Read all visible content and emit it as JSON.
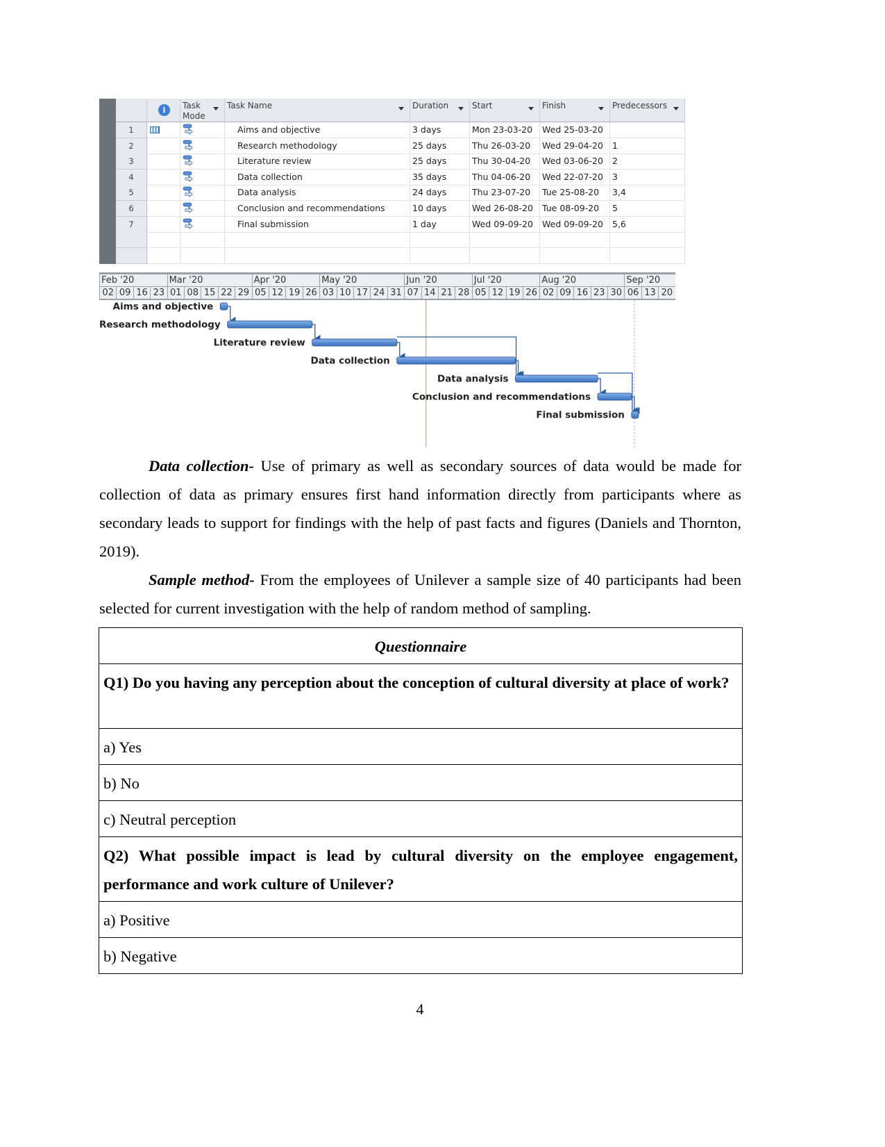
{
  "project_table": {
    "columns": {
      "info": "i",
      "task_mode": "Task Mode",
      "task_name": "Task Name",
      "duration": "Duration",
      "start": "Start",
      "finish": "Finish",
      "predecessors": "Predecessors"
    },
    "rows": [
      {
        "id": "1",
        "name": "Aims and objective",
        "duration": "3 days",
        "start": "Mon 23-03-20",
        "finish": "Wed 25-03-20",
        "predecessors": "",
        "indicator": "calendar-icon"
      },
      {
        "id": "2",
        "name": "Research methodology",
        "duration": "25 days",
        "start": "Thu 26-03-20",
        "finish": "Wed 29-04-20",
        "predecessors": "1"
      },
      {
        "id": "3",
        "name": "Literature review",
        "duration": "25 days",
        "start": "Thu 30-04-20",
        "finish": "Wed 03-06-20",
        "predecessors": "2"
      },
      {
        "id": "4",
        "name": "Data collection",
        "duration": "35 days",
        "start": "Thu 04-06-20",
        "finish": "Wed 22-07-20",
        "predecessors": "3"
      },
      {
        "id": "5",
        "name": "Data analysis",
        "duration": "24 days",
        "start": "Thu 23-07-20",
        "finish": "Tue 25-08-20",
        "predecessors": "3,4"
      },
      {
        "id": "6",
        "name": "Conclusion and recommendations",
        "duration": "10 days",
        "start": "Wed 26-08-20",
        "finish": "Tue 08-09-20",
        "predecessors": "5"
      },
      {
        "id": "7",
        "name": "Final submission",
        "duration": "1 day",
        "start": "Wed 09-09-20",
        "finish": "Wed 09-09-20",
        "predecessors": "5,6"
      }
    ]
  },
  "gantt": {
    "months": [
      "Feb '20",
      "Mar '20",
      "Apr '20",
      "May '20",
      "Jun '20",
      "Jul '20",
      "Aug '20",
      "Sep '20"
    ],
    "weeks": [
      "02",
      "09",
      "16",
      "23",
      "01",
      "08",
      "15",
      "22",
      "29",
      "05",
      "12",
      "19",
      "26",
      "03",
      "10",
      "17",
      "24",
      "31",
      "07",
      "14",
      "21",
      "28",
      "05",
      "12",
      "19",
      "26",
      "02",
      "09",
      "16",
      "23",
      "30",
      "06",
      "13",
      "20"
    ],
    "colors": {
      "bar": "#5b8fd6",
      "bar_edge": "#2f5d9e",
      "link": "#2f5d9e",
      "today_line": "#f0a060",
      "status_line": "#9aa0a8"
    }
  },
  "chart_data": {
    "type": "gantt",
    "title": "",
    "x_axis": {
      "start": "2020-02-02",
      "end": "2020-09-20",
      "major_unit": "month",
      "minor_unit": "week"
    },
    "tasks": [
      {
        "name": "Aims and objective",
        "start": "2020-03-23",
        "end": "2020-03-25",
        "predecessors": []
      },
      {
        "name": "Research methodology",
        "start": "2020-03-26",
        "end": "2020-04-29",
        "predecessors": [
          1
        ]
      },
      {
        "name": "Literature review",
        "start": "2020-04-30",
        "end": "2020-06-03",
        "predecessors": [
          2
        ]
      },
      {
        "name": "Data collection",
        "start": "2020-06-04",
        "end": "2020-07-22",
        "predecessors": [
          3
        ]
      },
      {
        "name": "Data analysis",
        "start": "2020-07-23",
        "end": "2020-08-25",
        "predecessors": [
          3,
          4
        ]
      },
      {
        "name": "Conclusion and recommendations",
        "start": "2020-08-26",
        "end": "2020-09-08",
        "predecessors": [
          5
        ]
      },
      {
        "name": "Final submission",
        "start": "2020-09-09",
        "end": "2020-09-09",
        "predecessors": [
          5,
          6
        ]
      }
    ],
    "current_date_line": "2020-06-16",
    "status_date_line": "2020-09-09"
  },
  "body": {
    "p1_lead": "Data collection-",
    "p1_text": " Use of primary as well as secondary sources of data would be made for collection of data as primary ensures first hand information directly from participants where as secondary leads to support for findings with the help of past facts and figures (Daniels and Thornton, 2019).",
    "p2_lead": "Sample method-",
    "p2_text": " From the employees of Unilever a sample size of 40 participants had been selected for current investigation with the help of random method of sampling."
  },
  "questionnaire": {
    "title": "Questionnaire",
    "q1": "Q1) Do you having any perception about the conception of cultural diversity at place of work?",
    "q1_options": [
      "a) Yes",
      "b) No",
      "c) Neutral perception"
    ],
    "q2": "Q2) What possible impact is lead by cultural diversity on the  employee engagement, performance and work culture of Unilever?",
    "q2_options": [
      "a) Positive",
      "b) Negative"
    ]
  },
  "page_number": "4"
}
